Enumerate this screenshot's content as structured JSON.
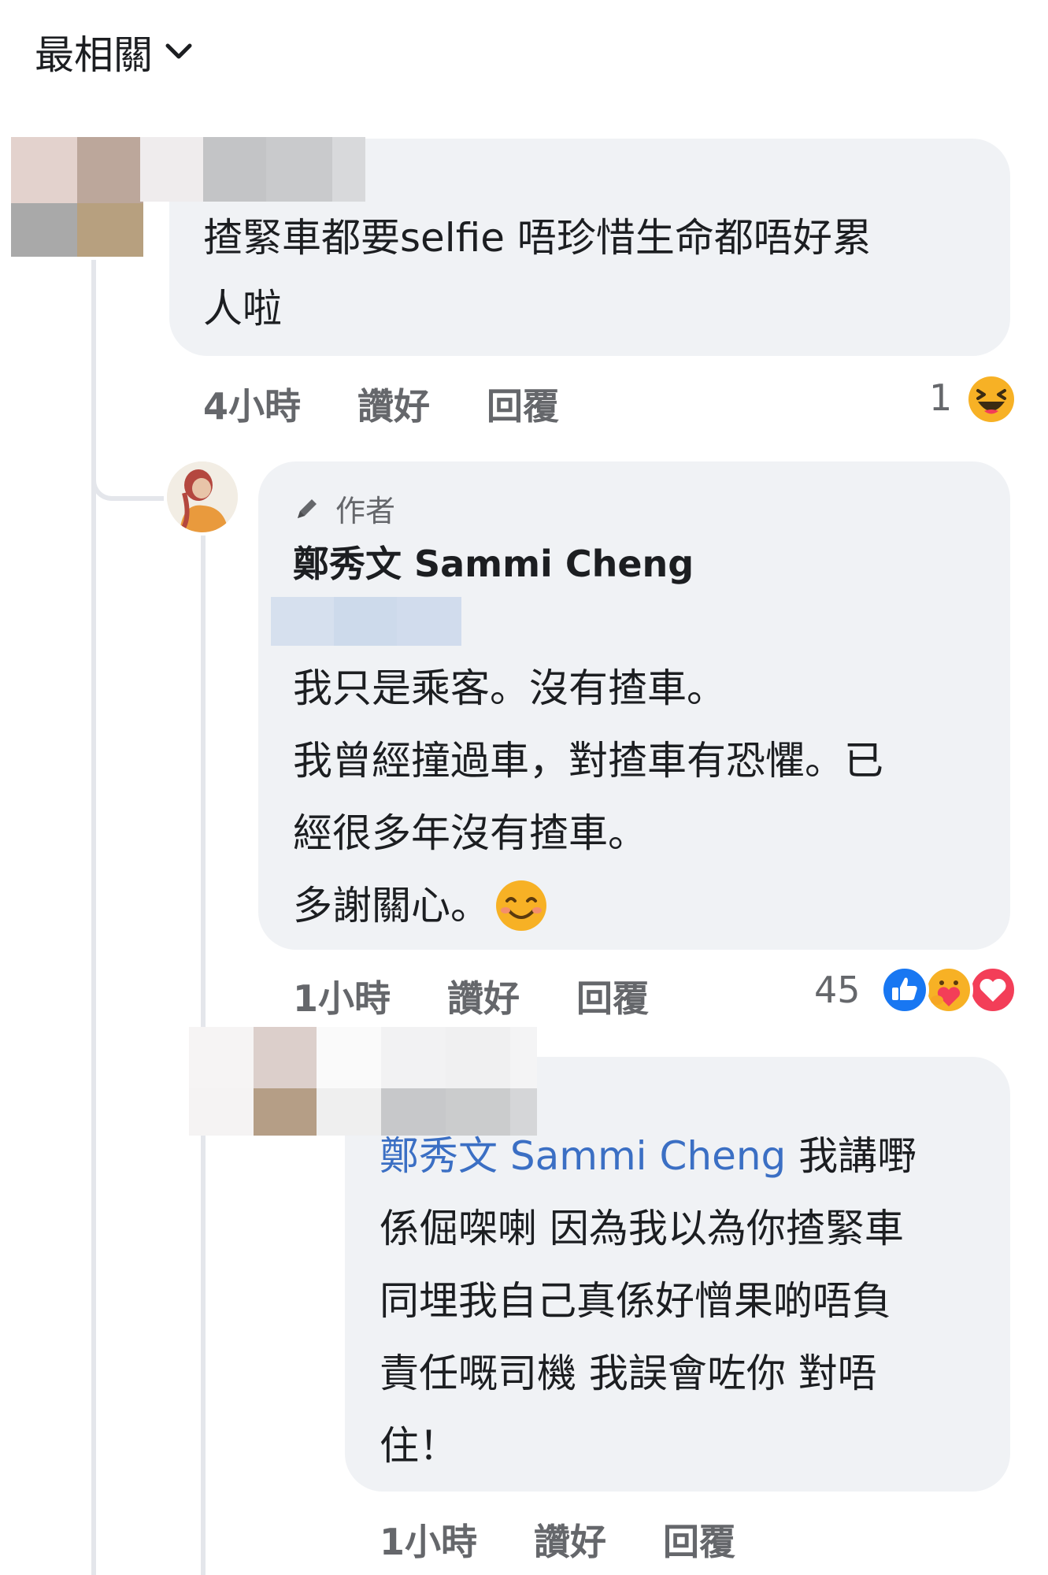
{
  "sort": {
    "label": "最相關",
    "icon": "chevron-down-icon"
  },
  "comments": [
    {
      "text_lines": [
        "揸緊車都要selfie 唔珍惜生命都唔好累",
        "人啦"
      ],
      "time": "4小時",
      "like_label": "讚好",
      "reply_label": "回覆",
      "reaction_count": "1",
      "reactions": [
        "haha"
      ]
    },
    {
      "author_badge": "作者",
      "author_name": "鄭秀文 Sammi Cheng",
      "text_lines": [
        "我只是乘客。沒有揸車。",
        "我曾經撞過車，對揸車有恐懼。已",
        "經很多年沒有揸車。",
        "多謝關心。"
      ],
      "time": "1小時",
      "like_label": "讚好",
      "reply_label": "回覆",
      "reaction_count": "45",
      "reactions": [
        "like",
        "care",
        "love"
      ]
    },
    {
      "mention": "鄭秀文 Sammi Cheng",
      "text_first": " 我講嘢",
      "text_lines": [
        "係倔㗎喇 因為我以為你揸緊車",
        "同埋我自己真係好憎果啲唔負",
        "責任嘅司機 我誤會咗你 對唔",
        "住！"
      ],
      "time": "1小時",
      "like_label": "讚好",
      "reply_label": "回覆"
    }
  ],
  "colors": {
    "bubble": "#f0f2f5",
    "action_text": "#65676b",
    "mention": "#3b6fc4",
    "like_blue": "#1877f2",
    "love_red": "#f33e58",
    "haha_yellow": "#f7b125"
  }
}
